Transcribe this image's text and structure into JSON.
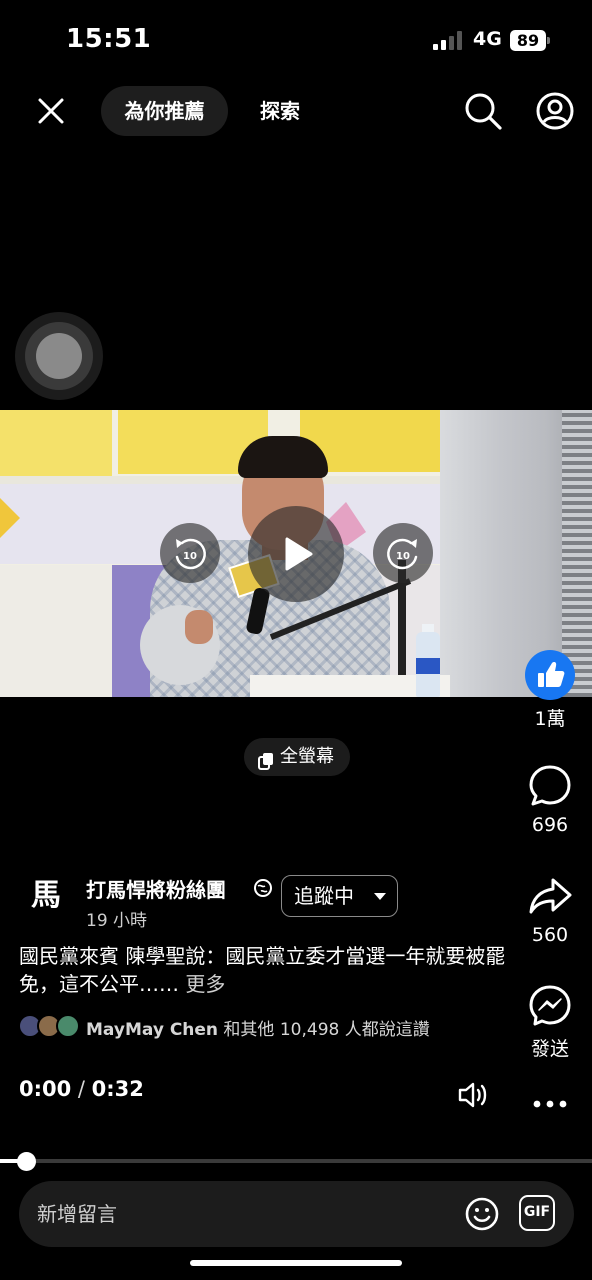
{
  "status_bar": {
    "time": "15:51",
    "network": "4G",
    "battery": "89"
  },
  "nav": {
    "tabs": [
      {
        "label": "為你推薦",
        "active": true
      },
      {
        "label": "探索",
        "active": false
      }
    ],
    "icons": [
      "close-icon",
      "search-icon",
      "profile-icon"
    ]
  },
  "video": {
    "rewind_seconds": "10",
    "forward_seconds": "10",
    "fullscreen_label": "全螢幕"
  },
  "actions": {
    "like_count": "1萬",
    "comment_count": "696",
    "share_count": "560",
    "send_label": "發送"
  },
  "post": {
    "page_avatar_text": "馬",
    "page_name": "打馬悍將粉絲團",
    "follow_label": "追蹤中",
    "time_ago": "19 小時",
    "caption": "國民黨來賓 陳學聖說：國民黨立委才當選一年就要被罷免，這不公平…… ",
    "more_label": "更多",
    "likes_name": "MayMay Chen",
    "likes_rest": " 和其他 10,498 人都說這讚"
  },
  "playback": {
    "current_time": "0:00",
    "separator": " / ",
    "duration": "0:32",
    "progress_fraction": 0.04
  },
  "comment_bar": {
    "placeholder": "新增留言",
    "gif_label": "GIF"
  },
  "colors": {
    "like_blue": "#1877f2",
    "background": "#000000"
  }
}
